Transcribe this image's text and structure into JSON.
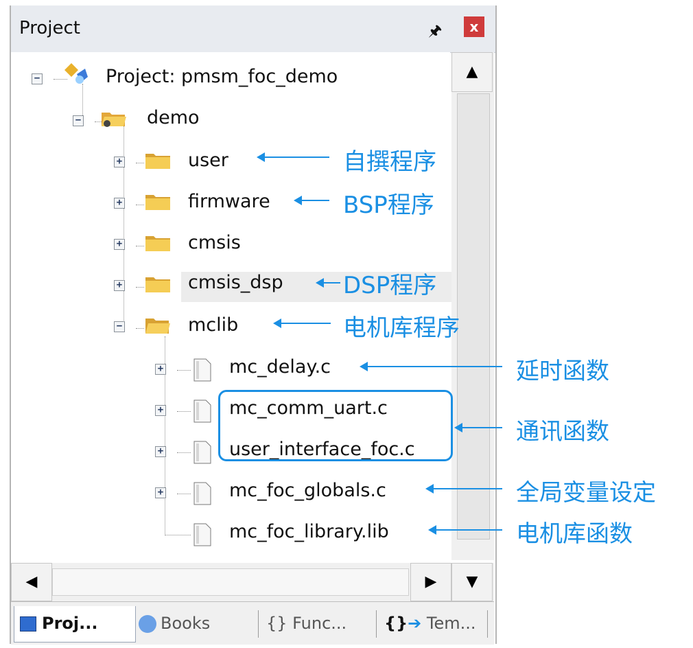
{
  "panel": {
    "title": "Project",
    "pin_icon": "pin-icon",
    "close_label": "x"
  },
  "tree": {
    "root": {
      "label": "Project: pmsm_foc_demo"
    },
    "target": {
      "label": "demo"
    },
    "groups": [
      {
        "label": "user"
      },
      {
        "label": "firmware"
      },
      {
        "label": "cmsis"
      },
      {
        "label": "cmsis_dsp"
      },
      {
        "label": "mclib"
      }
    ],
    "files": [
      {
        "label": "mc_delay.c"
      },
      {
        "label": "mc_comm_uart.c"
      },
      {
        "label": "user_interface_foc.c"
      },
      {
        "label": "mc_foc_globals.c"
      },
      {
        "label": "mc_foc_library.lib"
      }
    ]
  },
  "tabs": [
    {
      "label": "Proj..."
    },
    {
      "label": "Books"
    },
    {
      "label": "{} Func..."
    },
    {
      "label": "Tem..."
    }
  ],
  "annotations": {
    "user": "自撰程序",
    "firmware": "BSP程序",
    "cmsis_dsp": "DSP程序",
    "mclib": "电机库程序",
    "mc_delay": "延时函数",
    "comm": "通讯函数",
    "globals": "全局变量设定",
    "library": "电机库函数"
  },
  "colors": {
    "annotation": "#1a8fe3",
    "close": "#cf3b3b",
    "titlebar": "#e8ebf0"
  }
}
